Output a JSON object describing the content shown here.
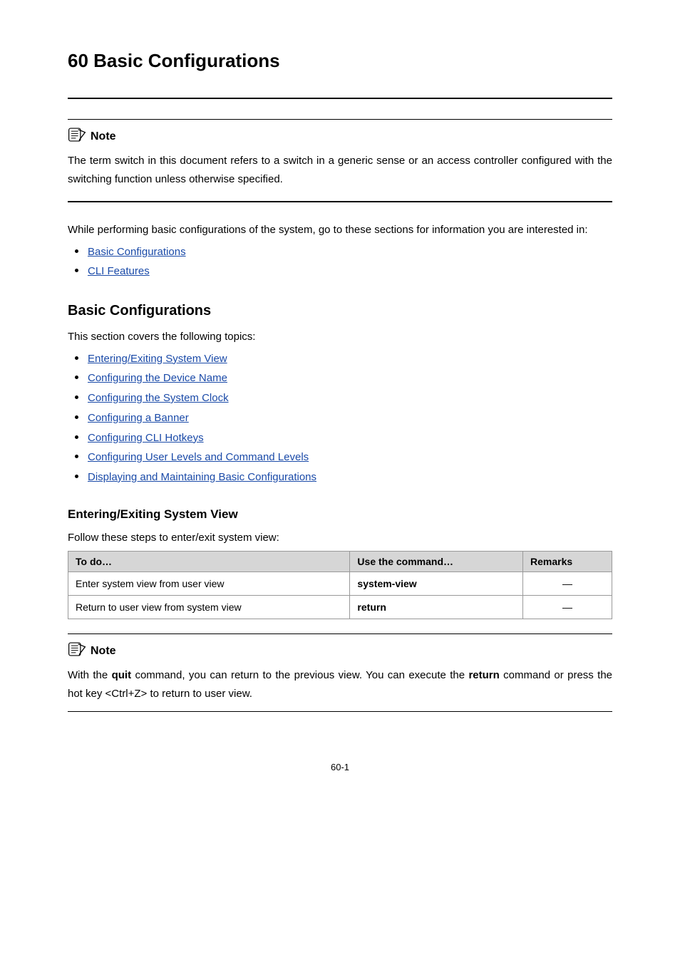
{
  "chapter": {
    "number": "60",
    "title": "Basic Configurations"
  },
  "callouts": {
    "note_label": "Note",
    "note1_text": "The term switch in this document refers to a switch in a generic sense or an access controller configured with the switching function unless otherwise specified.",
    "note2_prefix": "With the ",
    "note2_cmd1": "quit",
    "note2_mid": " command, you can return to the previous view. You can execute the ",
    "note2_cmd2": "return",
    "note2_tail": " command or press the hot key <Ctrl+Z> to return to user view."
  },
  "intro": {
    "lead": "While performing basic configurations of the system, go to these sections for information you are interested in:",
    "links": [
      "Basic Configurations",
      "CLI Features"
    ]
  },
  "section1": {
    "heading": "Basic Configurations",
    "lead": "This section covers the following topics:",
    "links": [
      "Entering/Exiting System View",
      "Configuring the Device Name",
      "Configuring the System Clock",
      "Configuring a Banner",
      "Configuring CLI Hotkeys",
      "Configuring User Levels and Command Levels",
      "Displaying and Maintaining Basic Configurations"
    ]
  },
  "subsection": {
    "heading": "Entering/Exiting System View",
    "lead": "Follow these steps to enter/exit system view:"
  },
  "table": {
    "headers": [
      "To do…",
      "Use the command…",
      "Remarks"
    ],
    "rows": [
      {
        "todo": "Enter system view from user view",
        "cmd": "system-view",
        "remarks": "—"
      },
      {
        "todo": "Return to user view from system view",
        "cmd": "return",
        "remarks": "—"
      }
    ]
  },
  "page_number": "60-1"
}
